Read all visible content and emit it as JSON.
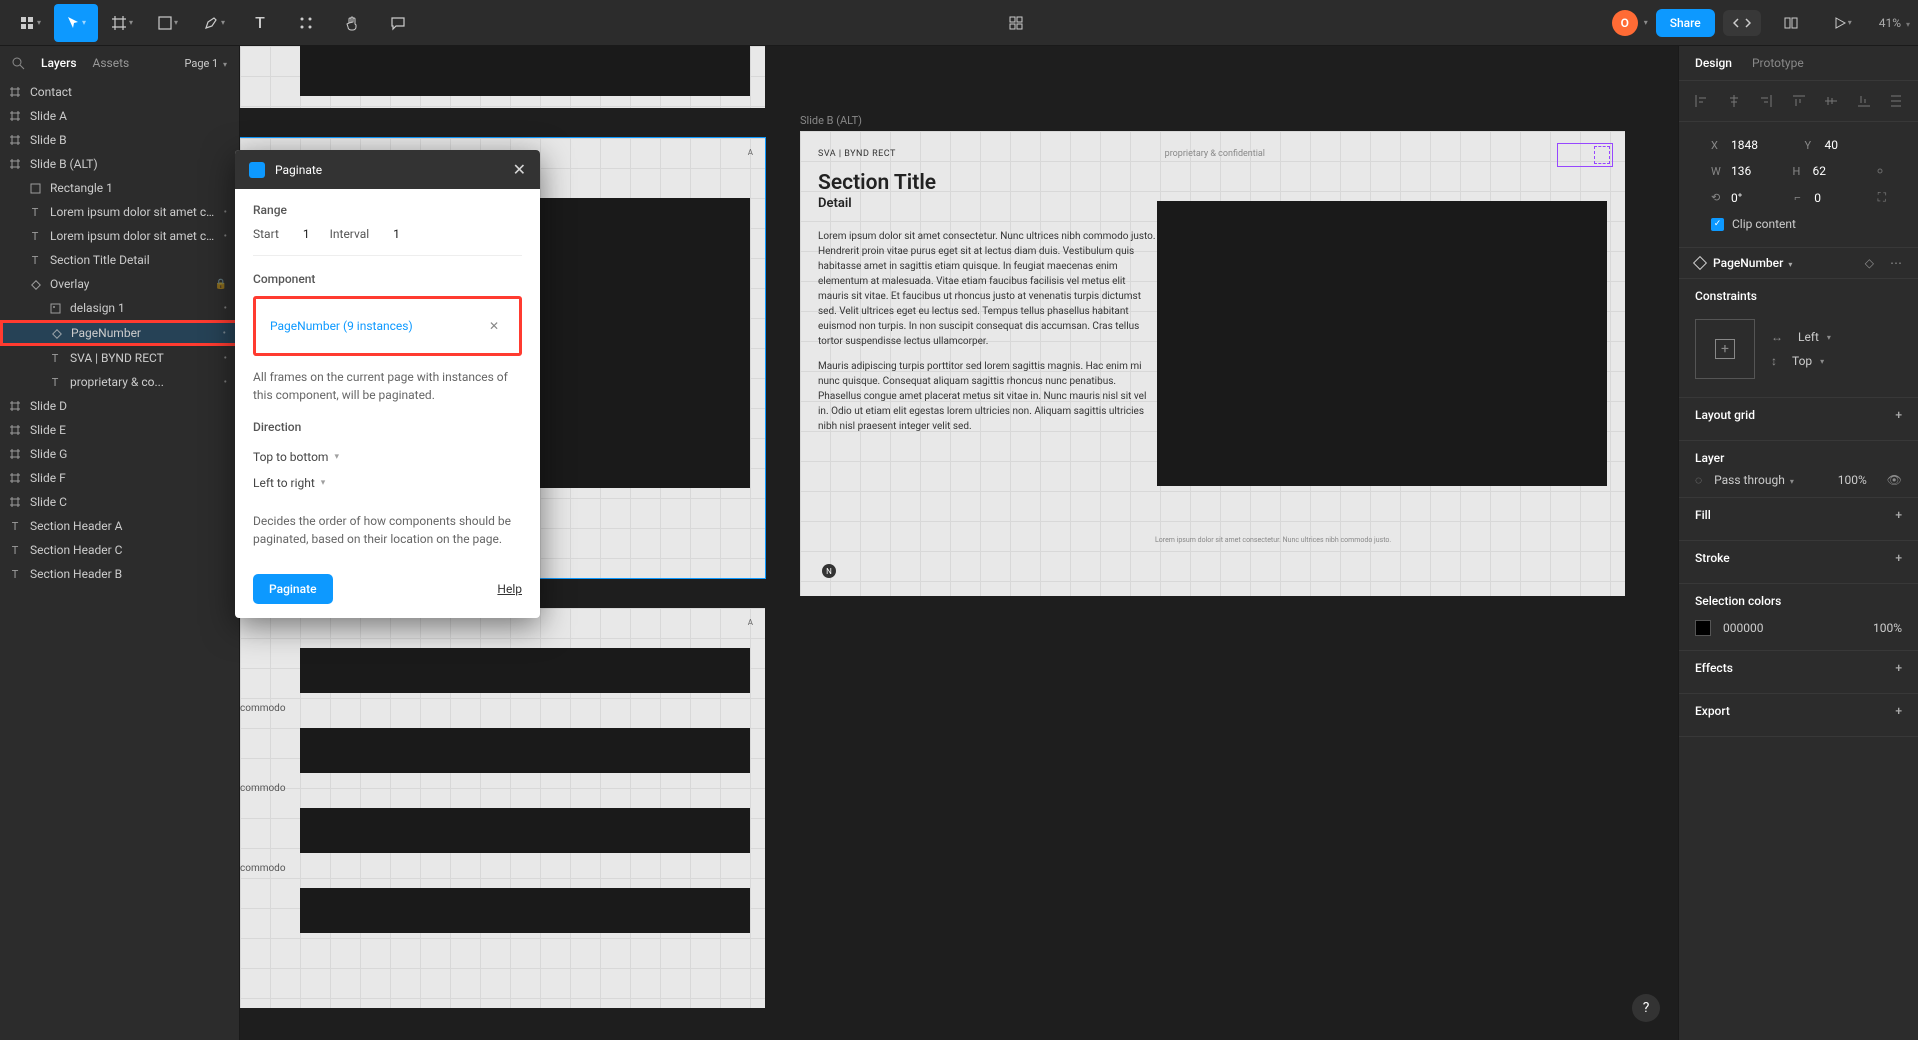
{
  "toolbar": {
    "zoom": "41%",
    "share": "Share",
    "avatar": "O"
  },
  "leftPanel": {
    "tabs": {
      "layers": "Layers",
      "assets": "Assets"
    },
    "page": "Page 1",
    "layers": [
      {
        "name": "Contact",
        "icon": "frame",
        "indent": 0
      },
      {
        "name": "Slide A",
        "icon": "frame",
        "indent": 0
      },
      {
        "name": "Slide B",
        "icon": "frame",
        "indent": 0
      },
      {
        "name": "Slide B (ALT)",
        "icon": "frame",
        "indent": 0
      },
      {
        "name": "Rectangle 1",
        "icon": "rect",
        "indent": 1
      },
      {
        "name": "Lorem ipsum dolor sit amet co...",
        "icon": "text",
        "indent": 1,
        "dot": true
      },
      {
        "name": "Lorem ipsum dolor sit amet co...",
        "icon": "text",
        "indent": 1,
        "dot": true
      },
      {
        "name": "Section Title Detail",
        "icon": "text",
        "indent": 1
      },
      {
        "name": "Overlay",
        "icon": "diamond",
        "indent": 1,
        "lock": true
      },
      {
        "name": "delasign 1",
        "icon": "image",
        "indent": 2,
        "dot": true
      },
      {
        "name": "PageNumber",
        "icon": "diamond",
        "indent": 2,
        "dot": true,
        "highlighted": true,
        "selected": true
      },
      {
        "name": "SVA | BYND RECT",
        "icon": "text",
        "indent": 2,
        "dot": true
      },
      {
        "name": "proprietary & co...",
        "icon": "text",
        "indent": 2,
        "dot": true
      },
      {
        "name": "Slide D",
        "icon": "frame",
        "indent": 0
      },
      {
        "name": "Slide E",
        "icon": "frame",
        "indent": 0
      },
      {
        "name": "Slide G",
        "icon": "frame",
        "indent": 0
      },
      {
        "name": "Slide F",
        "icon": "frame",
        "indent": 0
      },
      {
        "name": "Slide C",
        "icon": "frame",
        "indent": 0
      },
      {
        "name": "Section Header A",
        "icon": "text",
        "indent": 0
      },
      {
        "name": "Section Header C",
        "icon": "text",
        "indent": 0
      },
      {
        "name": "Section Header B",
        "icon": "text",
        "indent": 0
      }
    ]
  },
  "dialog": {
    "title": "Paginate",
    "range_label": "Range",
    "start_label": "Start",
    "start_value": "1",
    "interval_label": "Interval",
    "interval_value": "1",
    "component_label": "Component",
    "component_name": "PageNumber (9 instances)",
    "component_desc": "All frames on the current page with instances of this component, will be paginated.",
    "direction_label": "Direction",
    "dir_opt1": "Top to bottom",
    "dir_opt2": "Left to right",
    "direction_desc": "Decides the order of how components should be paginated, based on their location on the page.",
    "paginate_btn": "Paginate",
    "help": "Help"
  },
  "canvas": {
    "slideB_label": "Slide B (ALT)",
    "slideB": {
      "header": "SVA | BYND RECT",
      "prop": "proprietary & confidential",
      "title": "Section Title",
      "detail": "Detail",
      "para1": "Lorem ipsum dolor sit amet consectetur. Nunc ultrices nibh commodo justo. Hendrerit proin vitae purus eget sit at lectus diam duis. Vestibulum quis habitasse amet in sagittis etiam quisque. In feugiat maecenas enim elementum at malesuada. Vitae etiam faucibus facilisis vel metus elit mauris sit vitae. Et faucibus ut rhoncus justo at venenatis turpis dictumst sed. Velit ultrices eget eu lectus sed. Tempus tellus phasellus habitant euismod non turpis. In non suscipit consequat dis accumsan. Cras tellus tortor suspendisse lectus ullamcorper.",
      "para2": "Mauris adipiscing turpis porttitor sed lorem sagittis magnis. Hac enim mi nunc quisque. Consequat aliquam sagittis rhoncus nunc penatibus. Phasellus congue amet placerat metus sit vitae in. Nunc mauris nisl sit vel in. Odio ut etiam elit egestas lorem ultricies non. Aliquam sagittis ultricies nibh nisl praesent integer velit sed.",
      "caption": "Lorem ipsum dolor sit amet consectetur. Nunc ultrices nibh commodo justo.",
      "pagenum": "N"
    },
    "commodo": "commodo"
  },
  "rightPanel": {
    "tabs": {
      "design": "Design",
      "prototype": "Prototype"
    },
    "x": "1848",
    "y": "40",
    "w": "136",
    "h": "62",
    "rotation": "0°",
    "radius": "0",
    "clip": "Clip content",
    "component": "PageNumber",
    "constraints_label": "Constraints",
    "constraint_h": "Left",
    "constraint_v": "Top",
    "layout_grid": "Layout grid",
    "layer_label": "Layer",
    "blend": "Pass through",
    "opacity": "100%",
    "fill": "Fill",
    "stroke": "Stroke",
    "selection_colors": "Selection colors",
    "color_hex": "000000",
    "color_pct": "100%",
    "effects": "Effects",
    "export": "Export"
  }
}
